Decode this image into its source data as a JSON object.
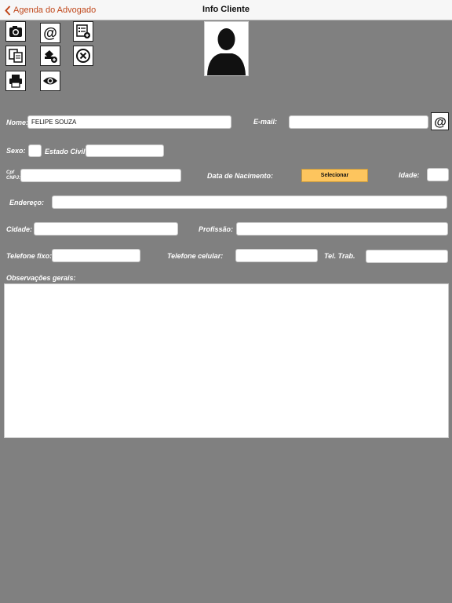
{
  "navbar": {
    "back_label": "Agenda do Advogado",
    "title": "Info Cliente"
  },
  "toolbar": {
    "icons": [
      "camera-icon",
      "at-icon",
      "list-add-icon",
      "copy-pages-icon",
      "scanner-add-icon",
      "close-circle-icon",
      "printer-icon",
      "eye-icon"
    ]
  },
  "form": {
    "nome_label": "Nome:",
    "nome_value": "FELIPE SOUZA",
    "email_label": "E-mail:",
    "email_value": "",
    "sexo_label": "Sexo:",
    "estado_civil_label": "Estado Civil:",
    "cpf_label": "Cpf",
    "cnpj_label": "CNPJ:",
    "data_nascimento_label": "Data de Nacimento:",
    "selecionar_label": "Selecionar",
    "idade_label": "Idade:",
    "endereco_label": "Endereço:",
    "cidade_label": "Cidade:",
    "profissao_label": "Profissão:",
    "telefone_fixo_label": "Telefone fixo:",
    "telefone_celular_label": "Telefone celular:",
    "tel_trab_label": "Tel. Trab.",
    "observacoes_label": "Observações gerais:"
  },
  "colors": {
    "background": "#808080",
    "accent": "#c0471a",
    "select_button": "#fdc55e"
  }
}
